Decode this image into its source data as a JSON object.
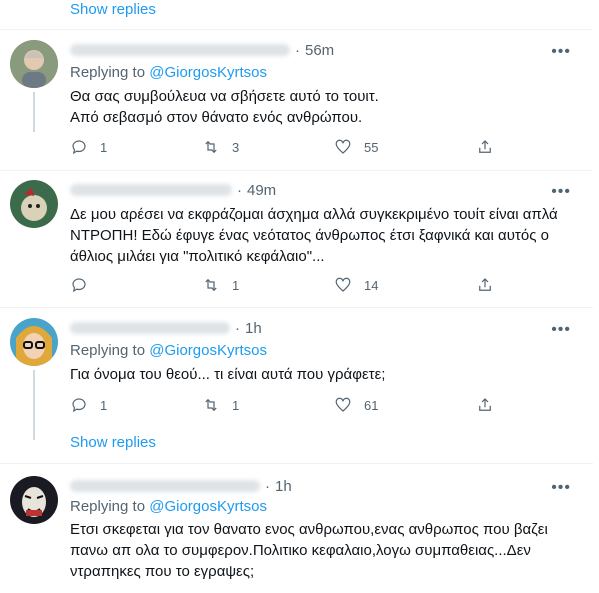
{
  "show_replies_label": "Show replies",
  "tweets": [
    {
      "time": "56m",
      "replying_prefix": "Replying to",
      "handle": "@GiorgosKyrtsos",
      "lines": [
        "Θα σας συμβούλευα να σβήσετε αυτό το τουιτ.",
        "Από σεβασμό στον θάνατο ενός ανθρώπου."
      ],
      "reply": "1",
      "retweet": "3",
      "like": "55"
    },
    {
      "time": "49m",
      "lines": [
        "Δε μου αρέσει να εκφράζομαι άσχημα αλλά συγκεκριμένο τουίτ είναι απλά",
        "ΝΤΡΟΠΗ! Εδώ έφυγε ένας νεότατος άνθρωπος έτσι ξαφνικά και αυτός ο",
        "άθλιος μιλάει για \"πολιτικό κεφάλαιο\"..."
      ],
      "reply": "",
      "retweet": "1",
      "like": "14"
    },
    {
      "time": "1h",
      "replying_prefix": "Replying to",
      "handle": "@GiorgosKyrtsos",
      "lines": [
        "Για όνομα του θεού... τι είναι αυτά που γράφετε;"
      ],
      "reply": "1",
      "retweet": "1",
      "like": "61"
    },
    {
      "time": "1h",
      "replying_prefix": "Replying to",
      "handle": "@GiorgosKyrtsos",
      "lines": [
        "Ετσι σκεφεται για τον θανατο ενος ανθρωπου,ενας ανθρωπος που βαζει",
        "πανω απ ολα το συμφερον.Πολιτικο κεφαλαιο,λογω συμπαθειας...Δεν",
        "ντραπηκες που το εγραψες;"
      ]
    }
  ]
}
